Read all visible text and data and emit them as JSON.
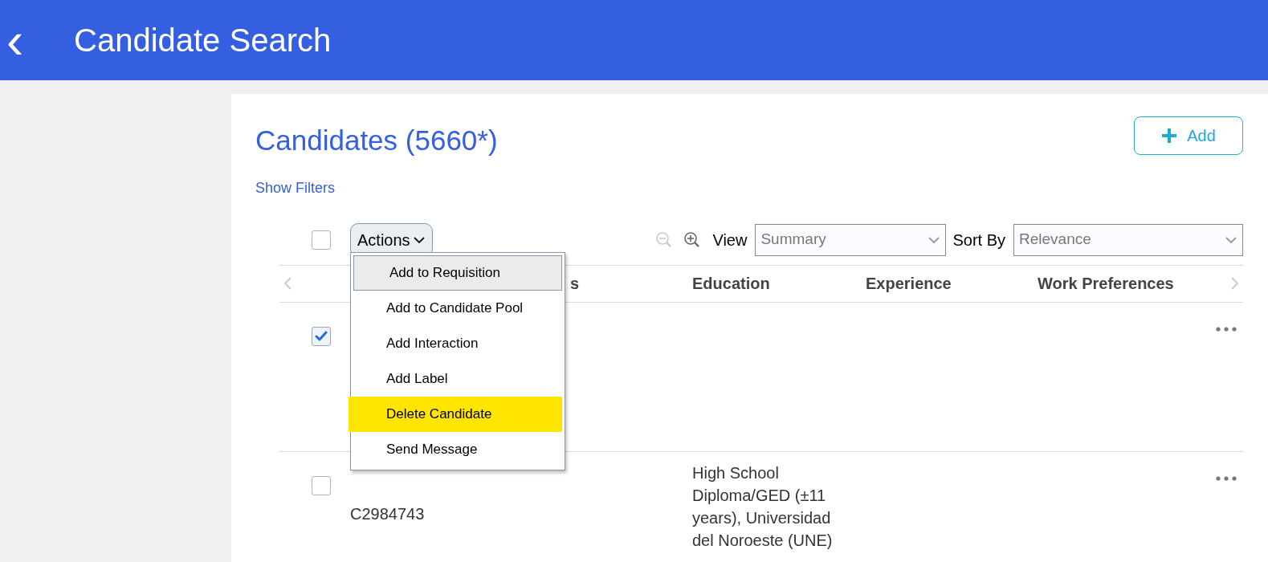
{
  "header": {
    "back_icon": "‹",
    "title": "Candidate Search"
  },
  "panel": {
    "title": "Candidates (5660*)",
    "add_button": "Add",
    "show_filters": "Show Filters"
  },
  "toolbar": {
    "select_all_checked": false,
    "actions_label": "Actions",
    "view_label": "View",
    "view_value": "Summary",
    "sort_label": "Sort By",
    "sort_value": "Relevance"
  },
  "actions_menu": [
    {
      "label": "Add to Requisition",
      "selected": true,
      "highlighted": false
    },
    {
      "label": "Add to Candidate Pool",
      "selected": false,
      "highlighted": false
    },
    {
      "label": "Add Interaction",
      "selected": false,
      "highlighted": false
    },
    {
      "label": "Add Label",
      "selected": false,
      "highlighted": false
    },
    {
      "label": "Delete Candidate",
      "selected": false,
      "highlighted": true
    },
    {
      "label": "Send Message",
      "selected": false,
      "highlighted": false
    }
  ],
  "table": {
    "columns": [
      "s",
      "Education",
      "Experience",
      "Work Preferences"
    ],
    "rows": [
      {
        "checked": true,
        "id": "",
        "education": ""
      },
      {
        "checked": false,
        "id": "C2984743",
        "education": "High School Diploma/GED (±11 years), Universidad del Noroeste (UNE)"
      }
    ]
  }
}
